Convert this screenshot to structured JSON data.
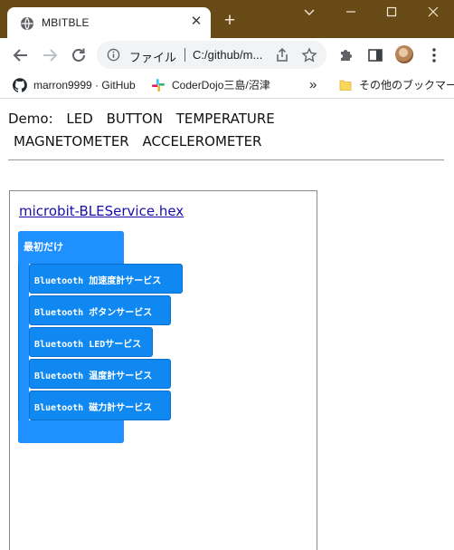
{
  "browser": {
    "tab_title": "MBITBLE",
    "tab_close": "✕",
    "new_tab": "+",
    "address_scheme_label": "ファイル",
    "address_url": "C:/github/m..."
  },
  "bookmarks": [
    {
      "label": "marron9999 · GitHub",
      "icon": "github-icon"
    },
    {
      "label": "CoderDojo三島/沼津",
      "icon": "slack-icon"
    },
    {
      "label": "»",
      "icon": "overflow-chevron-icon"
    },
    {
      "label": "その他のブックマーク",
      "icon": "folder-icon"
    }
  ],
  "page": {
    "demo_line1": [
      "Demo:",
      "LED",
      "BUTTON",
      "TEMPERATURE"
    ],
    "demo_line2": [
      "MAGNETOMETER",
      "ACCELEROMETER"
    ],
    "hex_link": "microbit-BLEService.hex",
    "blocks": {
      "outer_label": "最初だけ",
      "inner": [
        "Bluetooth 加速度計サービス",
        "Bluetooth ボタンサービス",
        "Bluetooth LEDサービス",
        "Bluetooth 温度計サービス",
        "Bluetooth 磁力計サービス"
      ]
    }
  },
  "colors": {
    "titlebar": "#684a17",
    "block_outer": "#1e90ff",
    "block_inner": "#0f88f2",
    "link": "#1a0dab"
  }
}
